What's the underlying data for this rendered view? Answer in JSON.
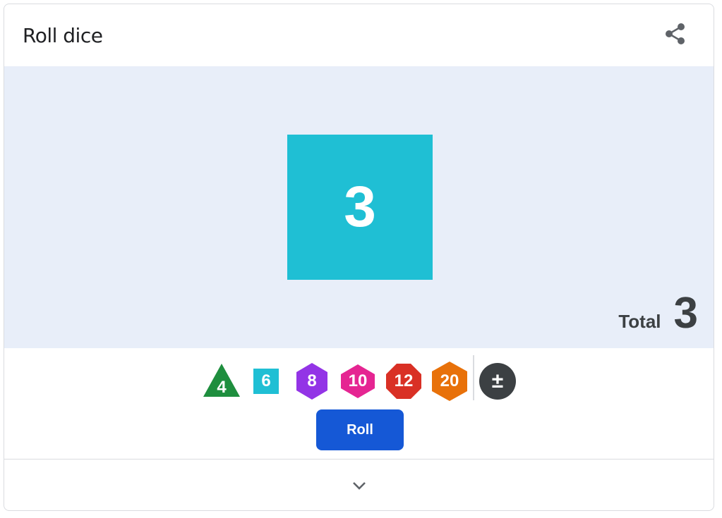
{
  "header": {
    "title": "Roll dice",
    "share_icon": "share-icon"
  },
  "result": {
    "face_value": "3",
    "die_color": "#1fbfd4"
  },
  "total": {
    "label": "Total",
    "value": "3"
  },
  "dice": [
    {
      "label": "4",
      "sides": "d4",
      "color": "#1e8e3e"
    },
    {
      "label": "6",
      "sides": "d6",
      "color": "#1fbfd4"
    },
    {
      "label": "8",
      "sides": "d8",
      "color": "#9334e6"
    },
    {
      "label": "10",
      "sides": "d10",
      "color": "#e52592"
    },
    {
      "label": "12",
      "sides": "d12",
      "color": "#d93025"
    },
    {
      "label": "20",
      "sides": "d20",
      "color": "#e8710a"
    }
  ],
  "modifier": {
    "label": "±",
    "color": "#3c4043"
  },
  "roll_button": {
    "label": "Roll",
    "color": "#1558d6"
  },
  "expand_icon": "chevron-down-icon"
}
